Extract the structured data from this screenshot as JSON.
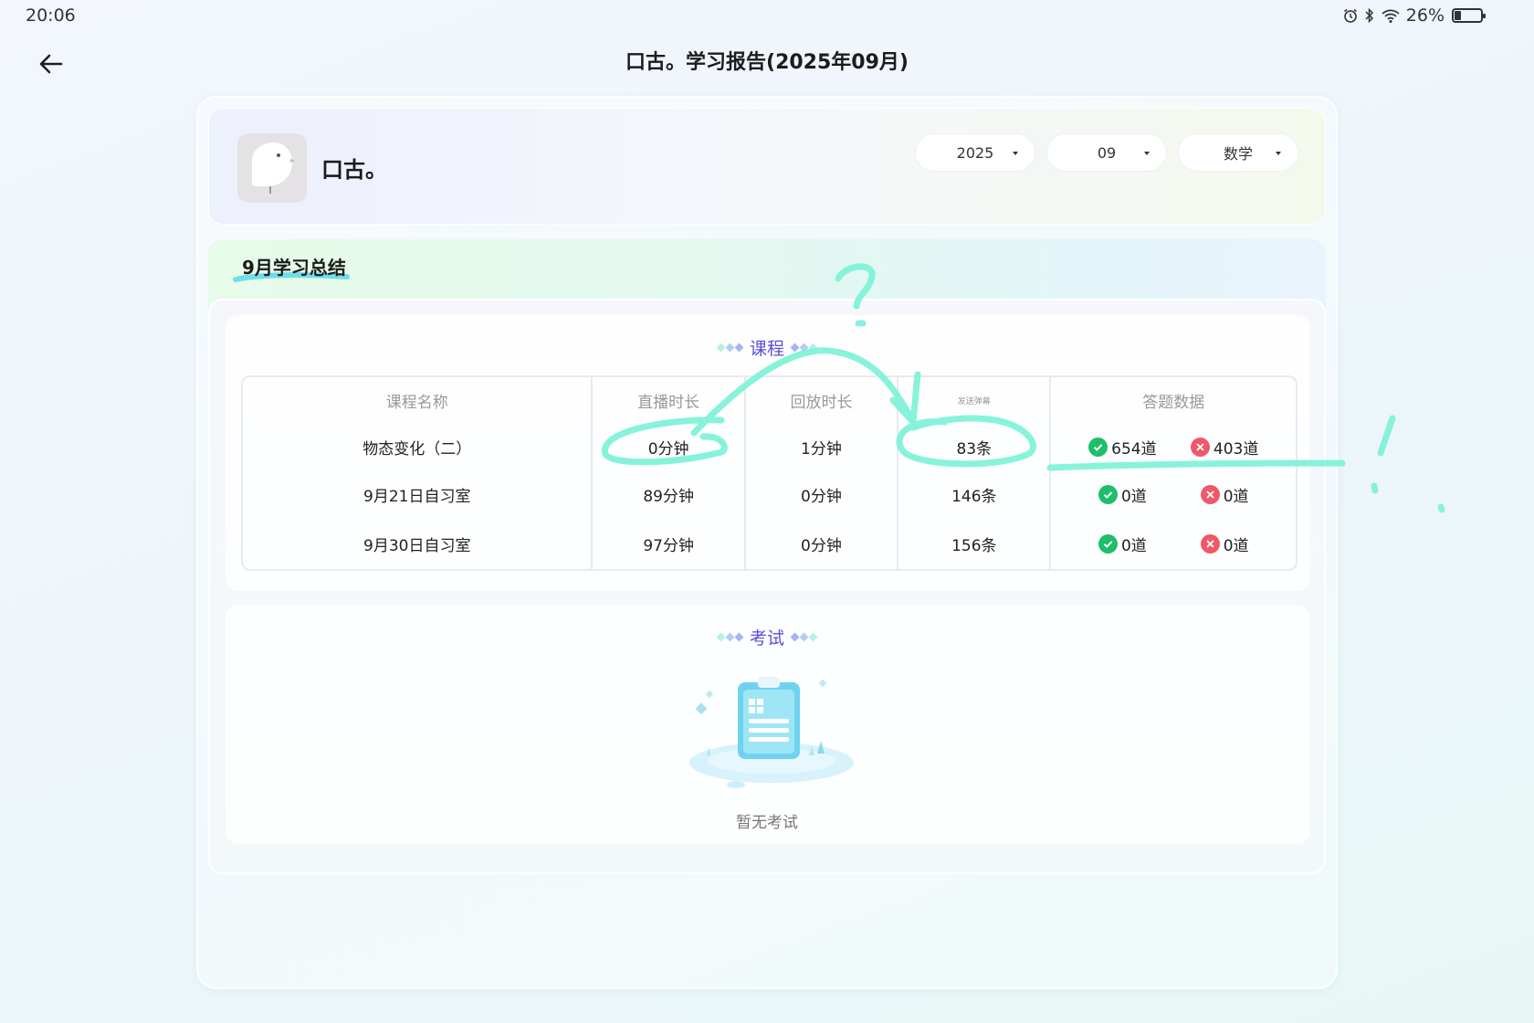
{
  "status_bar": {
    "time": "20:06",
    "battery_percent": "26%",
    "battery_level": 0.26,
    "icons": [
      "alarm-icon",
      "bluetooth-icon",
      "wifi-icon",
      "battery-icon"
    ]
  },
  "header": {
    "back_icon": "arrow-left-icon",
    "title": "口古。学习报告(2025年09月)"
  },
  "profile": {
    "name": "口古。",
    "avatar_icon": "bird-avatar-icon",
    "filters": {
      "year": "2025",
      "month": "09",
      "subject": "数学"
    }
  },
  "summary": {
    "title": "9月学习总结",
    "course_section": {
      "title": "课程",
      "columns": [
        "课程名称",
        "直播时长",
        "回放时长",
        "发送弹幕",
        "答题数据"
      ],
      "rows": [
        {
          "name": "物态变化（二）",
          "live": "0分钟",
          "replay": "1分钟",
          "danmaku": "83条",
          "correct": "654道",
          "wrong": "403道"
        },
        {
          "name": "9月21日自习室",
          "live": "89分钟",
          "replay": "0分钟",
          "danmaku": "146条",
          "correct": "0道",
          "wrong": "0道"
        },
        {
          "name": "9月30日自习室",
          "live": "97分钟",
          "replay": "0分钟",
          "danmaku": "156条",
          "correct": "0道",
          "wrong": "0道"
        }
      ]
    },
    "exam_section": {
      "title": "考试",
      "empty_icon": "clipboard-empty-icon",
      "empty_text": "暂无考试"
    }
  },
  "colors": {
    "accent_purple": "#5a4fd6",
    "correct_green": "#1fbe6a",
    "wrong_red": "#f0586a",
    "annotation_cyan": "#7ef2d8"
  }
}
